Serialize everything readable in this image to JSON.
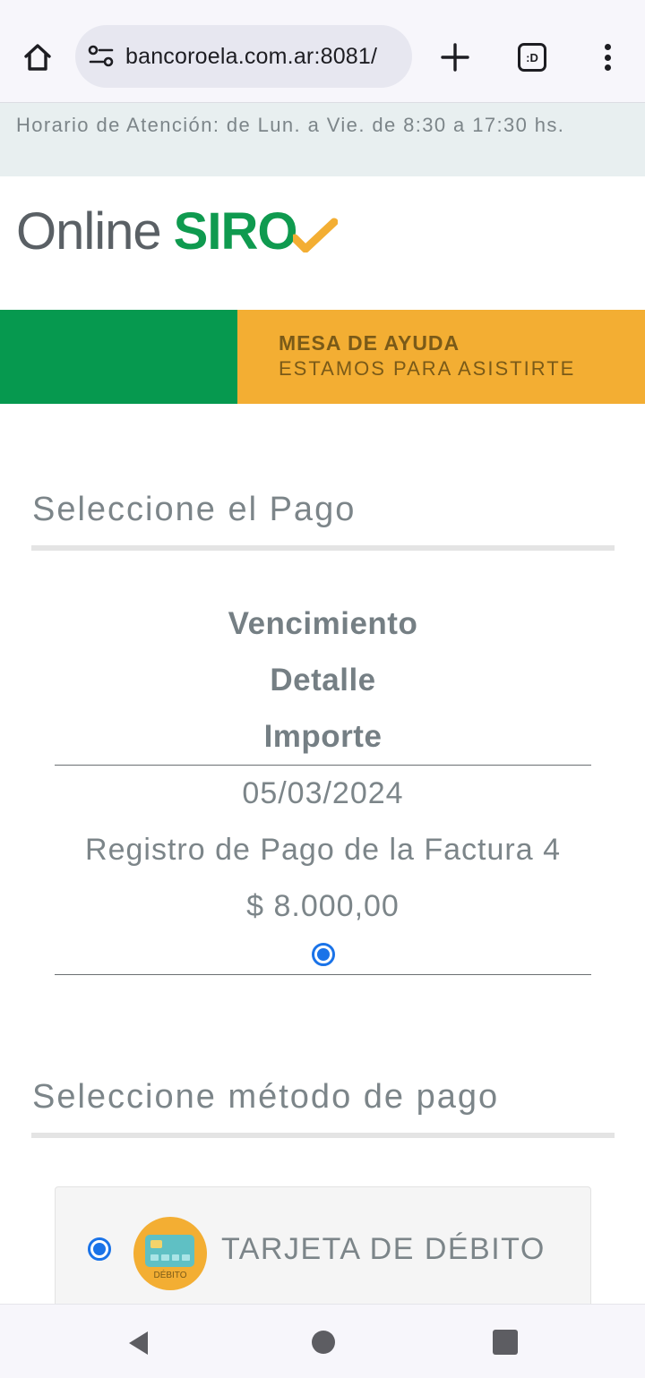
{
  "browser": {
    "url": "bancoroela.com.ar:8081/",
    "tabs_label": ":D"
  },
  "notice": {
    "text": "Horario de Atención: de Lun. a Vie. de 8:30 a 17:30 hs."
  },
  "logo": {
    "text_primary": "Online",
    "text_brand": "SIRO"
  },
  "banner": {
    "title": "MESA DE AYUDA",
    "subtitle": "ESTAMOS PARA ASISTIRTE",
    "colors": {
      "green": "#06994f",
      "yellow": "#f3ae33"
    }
  },
  "payment_section": {
    "heading": "Seleccione el Pago",
    "columns": [
      "Vencimiento",
      "Detalle",
      "Importe"
    ],
    "rows": [
      {
        "vencimiento": "05/03/2024",
        "detalle": "Registro de Pago de la Factura 4",
        "importe": "$ 8.000,00",
        "selected": true
      }
    ]
  },
  "method_section": {
    "heading": "Seleccione método de pago",
    "methods": [
      {
        "label": "TARJETA DE DÉBITO",
        "icon_caption": "DÉBITO",
        "icon": "debit-card-icon",
        "selected": true
      }
    ]
  },
  "theme": {
    "accent": "#1a73e8",
    "text_muted": "#7c8589"
  }
}
